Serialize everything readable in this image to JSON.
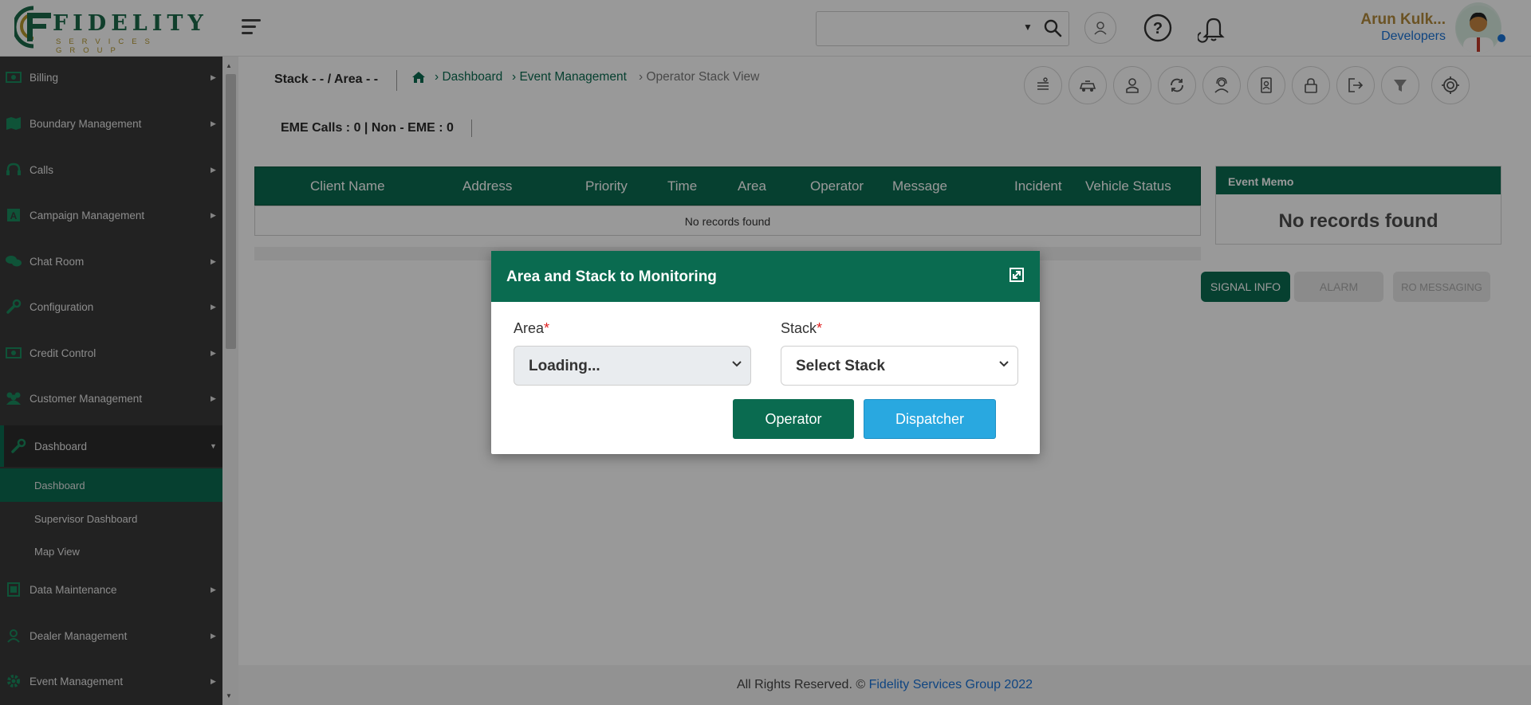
{
  "brand": {
    "logo_text": "FIDELITY",
    "logo_sub": "SERVICES GROUP"
  },
  "header": {
    "search": {
      "value": "",
      "placeholder": ""
    },
    "user": {
      "name": "Arun Kulk...",
      "role": "Developers"
    },
    "icons": [
      "agent-icon",
      "help-icon",
      "notification-bell-icon"
    ]
  },
  "sidebar": {
    "items": [
      {
        "label": "Billing",
        "icon": "billing-icon"
      },
      {
        "label": "Boundary Management",
        "icon": "map-icon"
      },
      {
        "label": "Calls",
        "icon": "headset-icon"
      },
      {
        "label": "Campaign Management",
        "icon": "campaign-icon"
      },
      {
        "label": "Chat Room",
        "icon": "chat-icon"
      },
      {
        "label": "Configuration",
        "icon": "wrench-icon"
      },
      {
        "label": "Credit Control",
        "icon": "money-icon"
      },
      {
        "label": "Customer Management",
        "icon": "users-icon"
      },
      {
        "label": "Dashboard",
        "icon": "wrench-icon"
      },
      {
        "label": "Data Maintenance",
        "icon": "database-icon"
      },
      {
        "label": "Dealer Management",
        "icon": "user-icon"
      },
      {
        "label": "Event Management",
        "icon": "gear-icon"
      }
    ],
    "dashboard_sub": [
      {
        "label": "Dashboard"
      },
      {
        "label": "Supervisor Dashboard"
      },
      {
        "label": "Map View"
      }
    ]
  },
  "page": {
    "stack_area": "Stack - - / Area - -",
    "breadcrumb": [
      "Dashboard",
      "Event Management",
      "Operator Stack View"
    ],
    "eme_calls": "EME Calls : 0 | Non - EME : 0",
    "toolbar_icons": [
      "stack-icon",
      "vehicle-icon",
      "operator-icon",
      "refresh-icon",
      "support-agent-icon",
      "contact-card-icon",
      "lock-icon",
      "logout-icon",
      "filter-icon",
      "target-icon"
    ]
  },
  "grid": {
    "columns": [
      "Client Name",
      "Address",
      "Priority",
      "Time",
      "Area",
      "Operator",
      "Message",
      "Incident",
      "Vehicle Status"
    ],
    "empty_text": "No records found"
  },
  "memo": {
    "title": "Event Memo",
    "empty_text": "No records found"
  },
  "actions": {
    "signal_info": "SIGNAL INFO",
    "alarm": "ALARM",
    "ro_messaging": "RO MESSAGING"
  },
  "footer": {
    "prefix": "All Rights Reserved. ©",
    "brand": "Fidelity Services Group 2022"
  },
  "modal": {
    "title": "Area and Stack to Monitoring",
    "area_label": "Area",
    "stack_label": "Stack",
    "required_mark": "*",
    "area_value": "Loading...",
    "stack_value": "Select Stack",
    "operator_button": "Operator",
    "dispatcher_button": "Dispatcher"
  },
  "colors": {
    "primary_green": "#0a6b50",
    "dispatcher_blue": "#29a8e0",
    "sidebar_bg": "#3a3a3a",
    "user_name": "#b38a3c",
    "user_role": "#1a73d8"
  }
}
